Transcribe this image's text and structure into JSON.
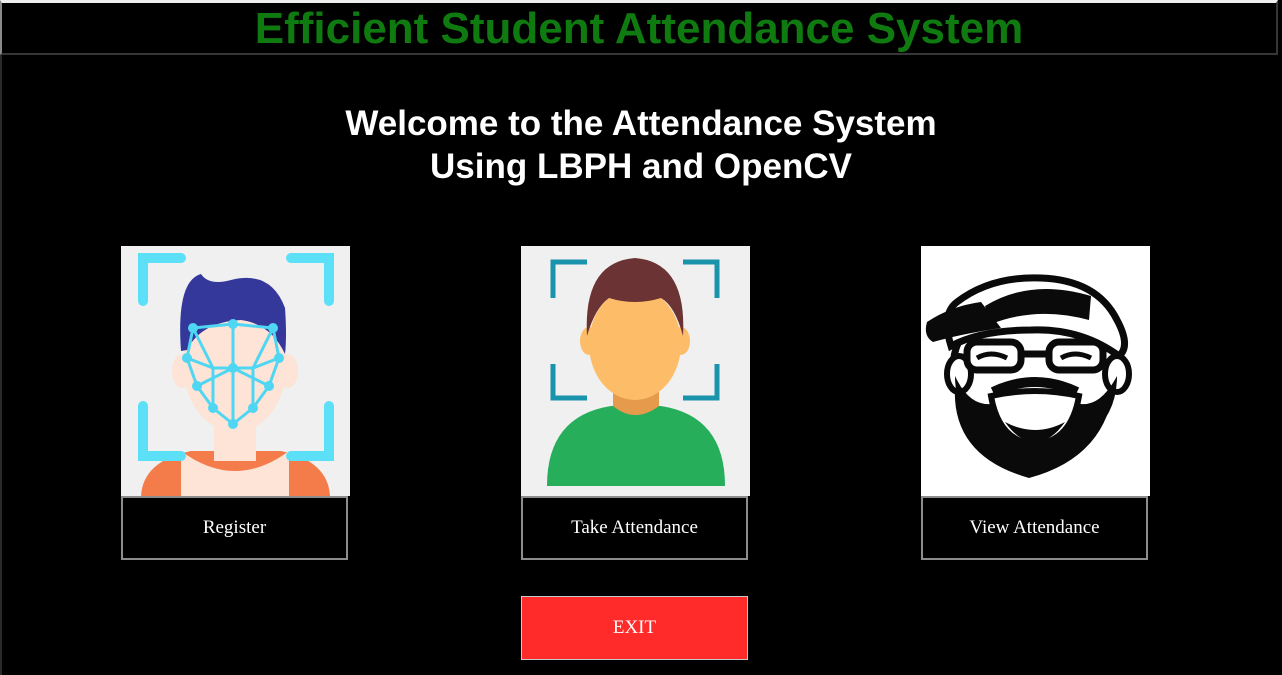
{
  "header": {
    "title": "Efficient Student Attendance System"
  },
  "welcome": {
    "line1": "Welcome to the Attendance System",
    "line2": "Using LBPH and OpenCV"
  },
  "tiles": [
    {
      "label": "Register",
      "icon": "face-scan-icon"
    },
    {
      "label": "Take Attendance",
      "icon": "face-frame-icon"
    },
    {
      "label": "View Attendance",
      "icon": "bearded-man-icon"
    }
  ],
  "exit": {
    "label": "EXIT"
  },
  "colors": {
    "title": "#0f7a0f",
    "exit": "#ff2a2a",
    "background": "#000000"
  }
}
